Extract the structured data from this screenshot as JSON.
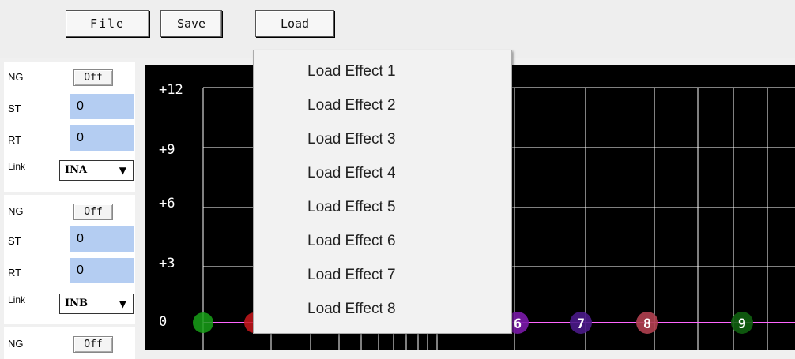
{
  "toolbar": {
    "file_label": "File",
    "save_label": "Save",
    "load_label": "Load"
  },
  "groups": [
    {
      "ng_label": "NG",
      "ng_value": "Off",
      "st_label": "ST",
      "st_value": "0",
      "rt_label": "RT",
      "rt_value": "0",
      "link_label": "Link",
      "link_value": "INA"
    },
    {
      "ng_label": "NG",
      "ng_value": "Off",
      "st_label": "ST",
      "st_value": "0",
      "rt_label": "RT",
      "rt_value": "0",
      "link_label": "Link",
      "link_value": "INB"
    },
    {
      "ng_label": "NG",
      "ng_value": "Off"
    }
  ],
  "graph": {
    "y_ticks": [
      "+12",
      "+9",
      "+6",
      "+3",
      "0"
    ],
    "point_labels": [
      "6",
      "7",
      "8",
      "9"
    ]
  },
  "load_menu": {
    "items": [
      "Load Effect 1",
      "Load Effect 2",
      "Load Effect 3",
      "Load Effect 4",
      "Load Effect 5",
      "Load Effect 6",
      "Load Effect 7",
      "Load Effect 8"
    ]
  },
  "colors": {
    "field_bg": "#b4cdf2",
    "graph_bg": "#000000",
    "eq_line": "#ff66ff"
  }
}
